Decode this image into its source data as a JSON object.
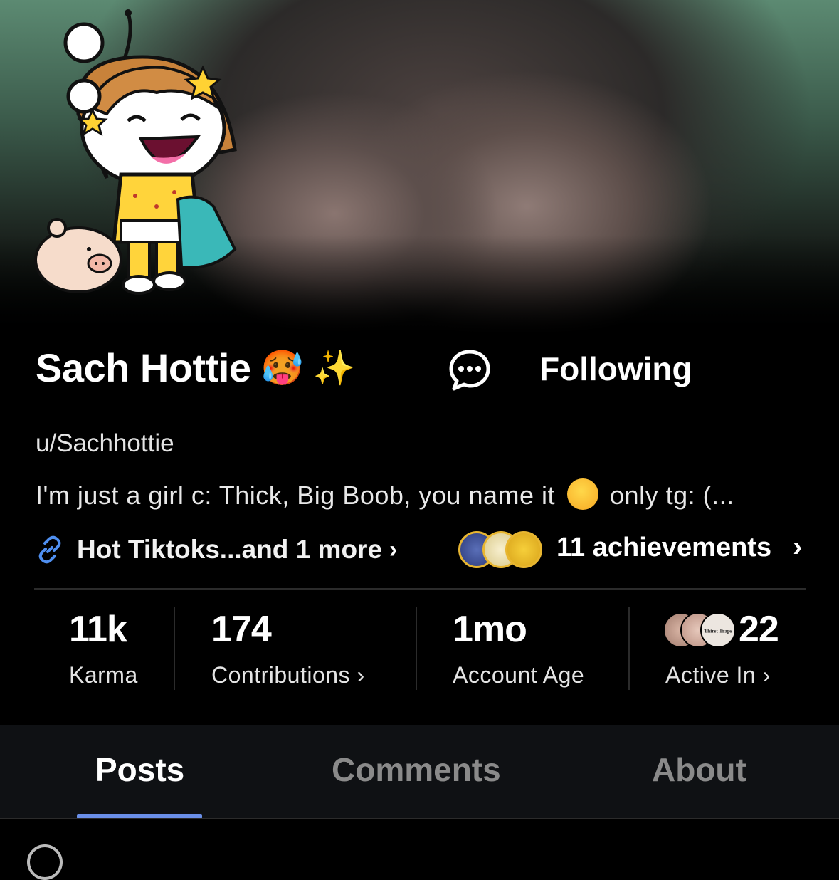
{
  "profile": {
    "display_name": "Sach Hottie",
    "display_emoji": "🥵 ✨",
    "username": "u/Sachhottie",
    "bio_part1": "I'm just a girl c: Thick, Big Boob, you name it",
    "bio_part2": "only tg: (...",
    "follow_label": "Following",
    "links_label": "Hot Tiktoks...and 1 more",
    "achievements_label": "11 achievements"
  },
  "stats": {
    "karma": {
      "value": "11k",
      "label": "Karma"
    },
    "contributions": {
      "value": "174",
      "label": "Contributions"
    },
    "account_age": {
      "value": "1mo",
      "label": "Account Age"
    },
    "active_in": {
      "value": "22",
      "label": "Active In"
    }
  },
  "tabs": [
    {
      "label": "Posts",
      "active": true
    },
    {
      "label": "Comments",
      "active": false
    },
    {
      "label": "About",
      "active": false
    }
  ],
  "active_in_avatar_text": "Thirst Traps",
  "icons": {
    "chat": "chat-bubble-icon",
    "link": "link-icon",
    "chevron": "chevron-right-icon"
  },
  "colors": {
    "background": "#000000",
    "tab_bar": "#0f1114",
    "active_tab_indicator": "#6a8fe8",
    "link_icon": "#4f8ff0",
    "inactive_tab": "#8a8a8a"
  }
}
